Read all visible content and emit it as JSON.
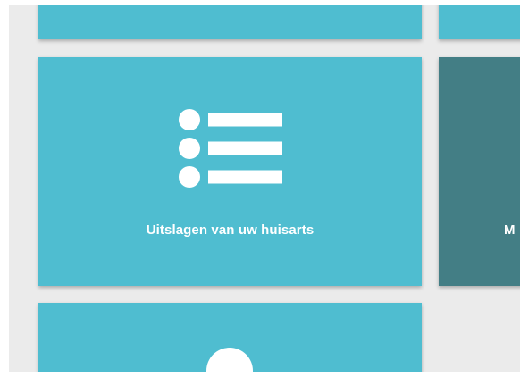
{
  "tiles": [
    {
      "id": "top-left",
      "label": ""
    },
    {
      "id": "top-right",
      "label": ""
    },
    {
      "id": "results",
      "label": "Uitslagen van uw huisarts",
      "icon": "list-icon"
    },
    {
      "id": "right-partial",
      "label": "M"
    },
    {
      "id": "bottom",
      "label": "",
      "icon": "person-icon"
    }
  ],
  "colors": {
    "background": "#ebebeb",
    "tile": "#4fbdd0",
    "tile_dark": "#437e85",
    "icon": "#ffffff"
  }
}
